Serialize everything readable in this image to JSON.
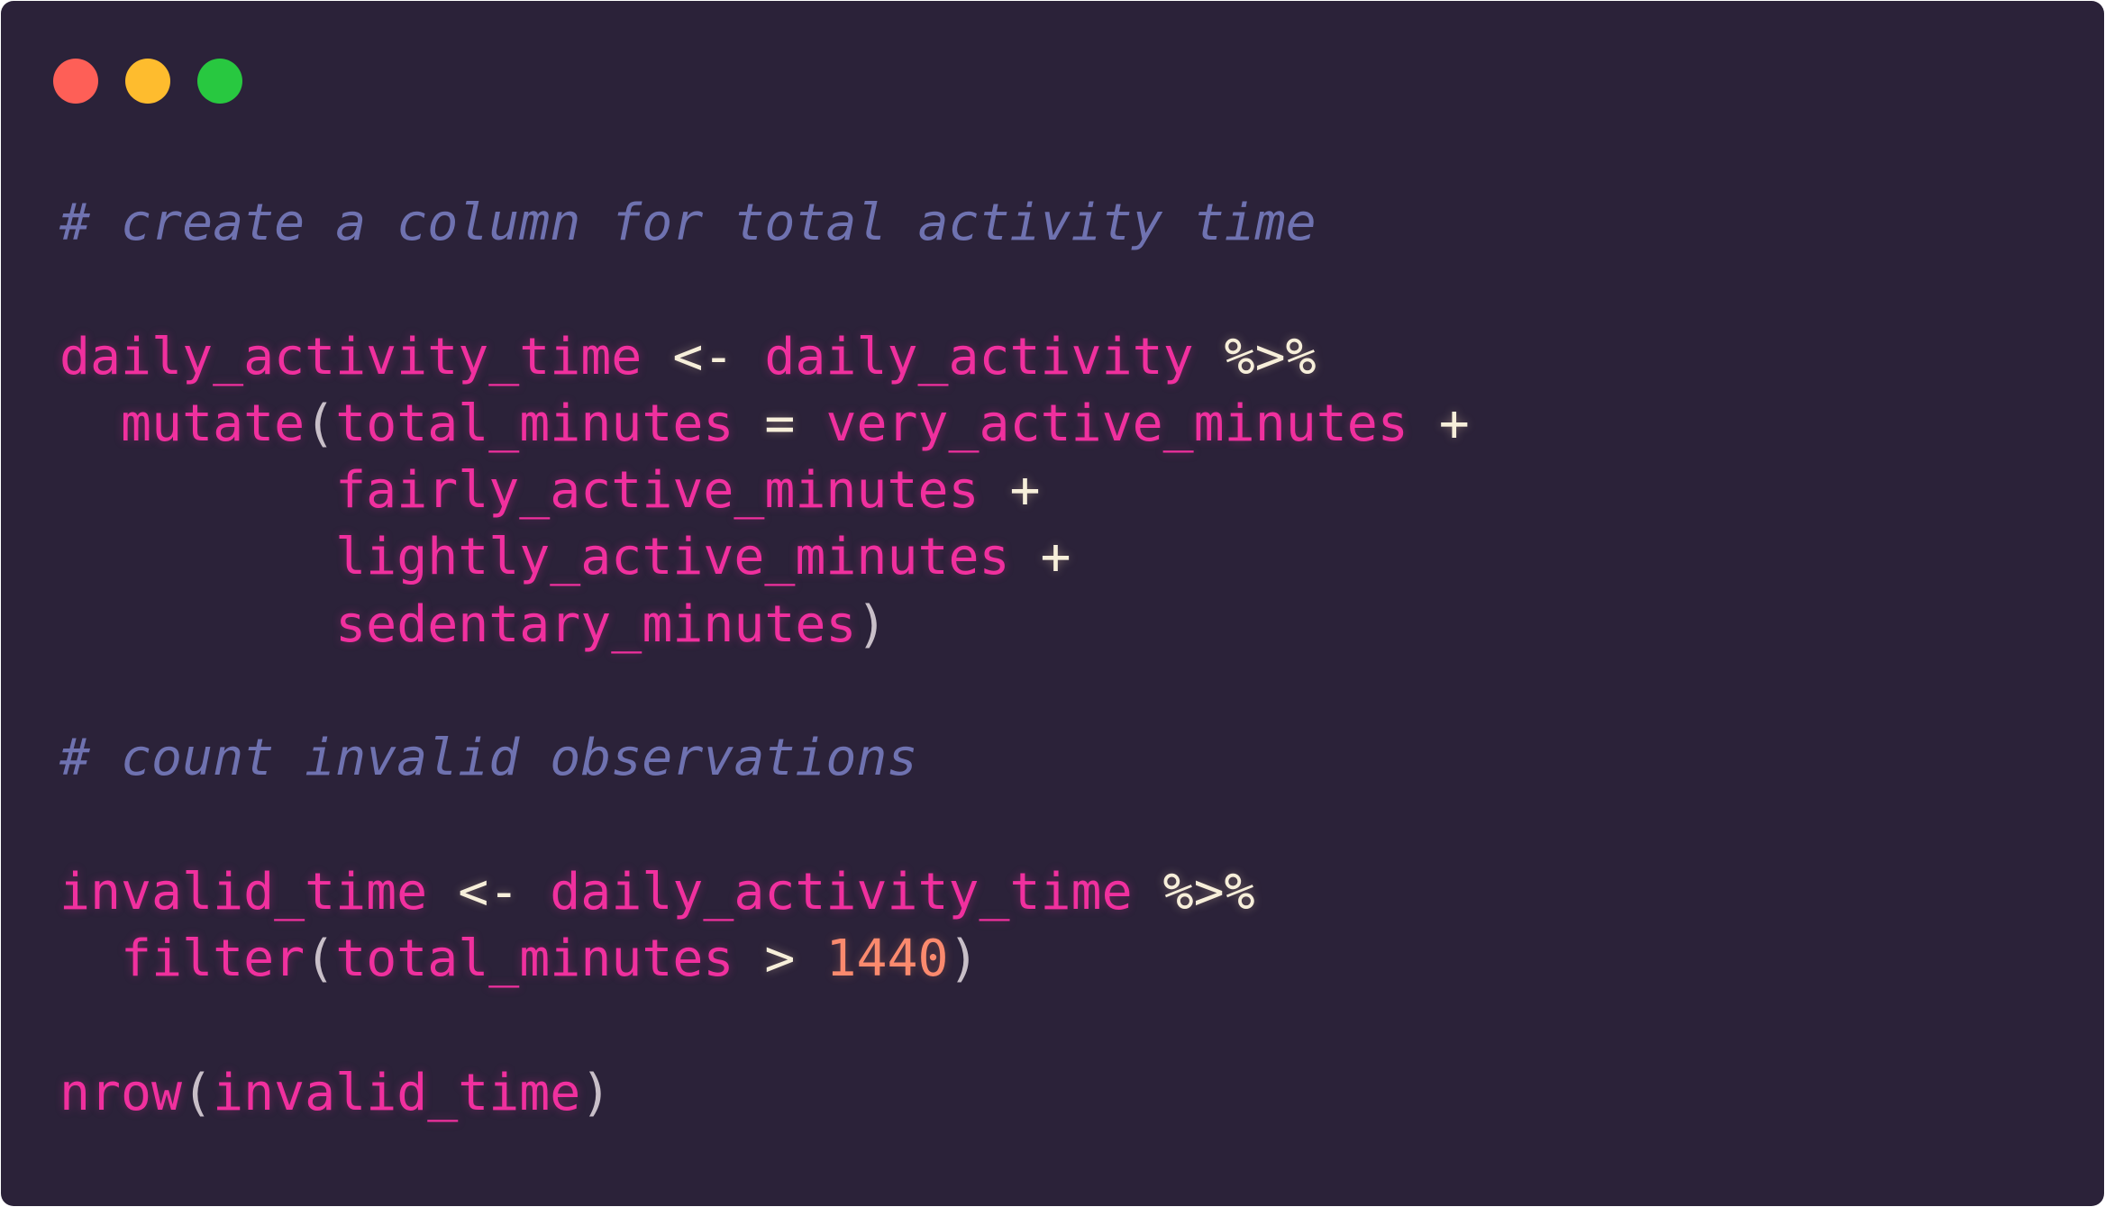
{
  "window": {
    "controls": [
      "close",
      "minimize",
      "zoom"
    ],
    "colors": {
      "background": "#2b2239",
      "close": "#fe5f57",
      "minimize": "#febc2e",
      "zoom": "#28c840",
      "identifier": "#f0309e",
      "comment": "#6f72b0",
      "operator": "#f7efda",
      "number": "#fb8a6e"
    }
  },
  "code": {
    "lines": [
      [
        {
          "t": "cm",
          "v": "# create a column for total activity time"
        }
      ],
      [],
      [
        {
          "t": "id",
          "v": "daily_activity_time"
        },
        {
          "t": "op",
          "v": " <- "
        },
        {
          "t": "id",
          "v": "daily_activity"
        },
        {
          "t": "op",
          "v": " %>%"
        }
      ],
      [
        {
          "t": "op",
          "v": "  "
        },
        {
          "t": "fn",
          "v": "mutate"
        },
        {
          "t": "pn",
          "v": "("
        },
        {
          "t": "id",
          "v": "total_minutes"
        },
        {
          "t": "op",
          "v": " = "
        },
        {
          "t": "id",
          "v": "very_active_minutes"
        },
        {
          "t": "op",
          "v": " +"
        }
      ],
      [
        {
          "t": "op",
          "v": "         "
        },
        {
          "t": "id",
          "v": "fairly_active_minutes"
        },
        {
          "t": "op",
          "v": " +"
        }
      ],
      [
        {
          "t": "op",
          "v": "         "
        },
        {
          "t": "id",
          "v": "lightly_active_minutes"
        },
        {
          "t": "op",
          "v": " +"
        }
      ],
      [
        {
          "t": "op",
          "v": "         "
        },
        {
          "t": "id",
          "v": "sedentary_minutes"
        },
        {
          "t": "pn",
          "v": ")"
        }
      ],
      [],
      [
        {
          "t": "cm",
          "v": "# count invalid observations"
        }
      ],
      [],
      [
        {
          "t": "id",
          "v": "invalid_time"
        },
        {
          "t": "op",
          "v": " <- "
        },
        {
          "t": "id",
          "v": "daily_activity_time"
        },
        {
          "t": "op",
          "v": " %>%"
        }
      ],
      [
        {
          "t": "op",
          "v": "  "
        },
        {
          "t": "fn",
          "v": "filter"
        },
        {
          "t": "pn",
          "v": "("
        },
        {
          "t": "id",
          "v": "total_minutes"
        },
        {
          "t": "op",
          "v": " > "
        },
        {
          "t": "nm",
          "v": "1440"
        },
        {
          "t": "pn",
          "v": ")"
        }
      ],
      [],
      [
        {
          "t": "fn",
          "v": "nrow"
        },
        {
          "t": "pn",
          "v": "("
        },
        {
          "t": "id",
          "v": "invalid_time"
        },
        {
          "t": "pn",
          "v": ")"
        }
      ]
    ]
  }
}
